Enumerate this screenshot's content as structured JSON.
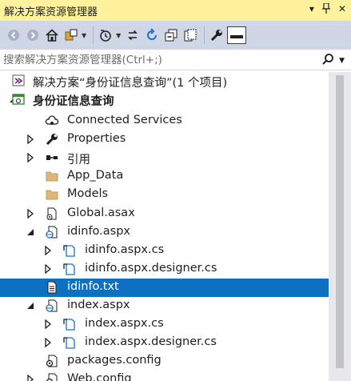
{
  "panel": {
    "title": "解决方案资源管理器",
    "controls": {
      "dropdown_icon": "chevron-down-icon",
      "pin_icon": "pin-icon",
      "close_icon": "close-icon"
    }
  },
  "toolbar": {
    "buttons": [
      {
        "name": "back-button",
        "icon": "back-arrow-icon"
      },
      {
        "name": "forward-button",
        "icon": "forward-arrow-icon"
      },
      {
        "name": "home-button",
        "icon": "home-icon"
      },
      {
        "name": "switch-views-button",
        "icon": "switch-views-icon"
      },
      {
        "name": "pending-changes-button",
        "icon": "history-icon"
      },
      {
        "name": "sync-button",
        "icon": "sync-icon"
      },
      {
        "name": "refresh-button",
        "icon": "refresh-icon"
      },
      {
        "name": "collapse-all-button",
        "icon": "collapse-all-icon"
      },
      {
        "name": "show-all-files-button",
        "icon": "show-all-files-icon"
      },
      {
        "name": "properties-button",
        "icon": "wrench-icon"
      },
      {
        "name": "preview-button",
        "icon": "preview-icon"
      }
    ]
  },
  "search": {
    "placeholder": "搜索解决方案资源管理器(Ctrl+;)",
    "icon": "search-icon"
  },
  "tree": {
    "items": [
      {
        "label": "解决方案“身份证信息查询”(1 个项目)",
        "icon": "solution-icon",
        "level": 0,
        "expander": "none"
      },
      {
        "label": "身份证信息查询",
        "icon": "web-project-icon",
        "level": 0,
        "expander": "expanded",
        "bold": true
      },
      {
        "label": "Connected Services",
        "icon": "connected-services-icon",
        "level": 1,
        "expander": "none"
      },
      {
        "label": "Properties",
        "icon": "wrench-icon",
        "level": 1,
        "expander": "collapsed"
      },
      {
        "label": "引用",
        "icon": "references-icon",
        "level": 1,
        "expander": "collapsed"
      },
      {
        "label": "App_Data",
        "icon": "folder-icon",
        "level": 1,
        "expander": "none"
      },
      {
        "label": "Models",
        "icon": "folder-icon",
        "level": 1,
        "expander": "none"
      },
      {
        "label": "Global.asax",
        "icon": "asax-file-icon",
        "level": 1,
        "expander": "collapsed"
      },
      {
        "label": "idinfo.aspx",
        "icon": "aspx-file-icon",
        "level": 1,
        "expander": "expanded"
      },
      {
        "label": "idinfo.aspx.cs",
        "icon": "cs-file-icon",
        "level": 2,
        "expander": "collapsed"
      },
      {
        "label": "idinfo.aspx.designer.cs",
        "icon": "cs-file-icon",
        "level": 2,
        "expander": "collapsed"
      },
      {
        "label": "idinfo.txt",
        "icon": "text-file-icon",
        "level": 1,
        "expander": "none",
        "selected": true
      },
      {
        "label": "index.aspx",
        "icon": "aspx-file-icon",
        "level": 1,
        "expander": "expanded"
      },
      {
        "label": "index.aspx.cs",
        "icon": "cs-file-icon",
        "level": 2,
        "expander": "collapsed"
      },
      {
        "label": "index.aspx.designer.cs",
        "icon": "cs-file-icon",
        "level": 2,
        "expander": "collapsed"
      },
      {
        "label": "packages.config",
        "icon": "config-file-icon",
        "level": 1,
        "expander": "none"
      },
      {
        "label": "Web.config",
        "icon": "config-file-icon",
        "level": 1,
        "expander": "collapsed"
      }
    ]
  },
  "colors": {
    "title_bar": "#fff29d",
    "toolbar": "#cfd6e5",
    "selection": "#0e70c0"
  }
}
